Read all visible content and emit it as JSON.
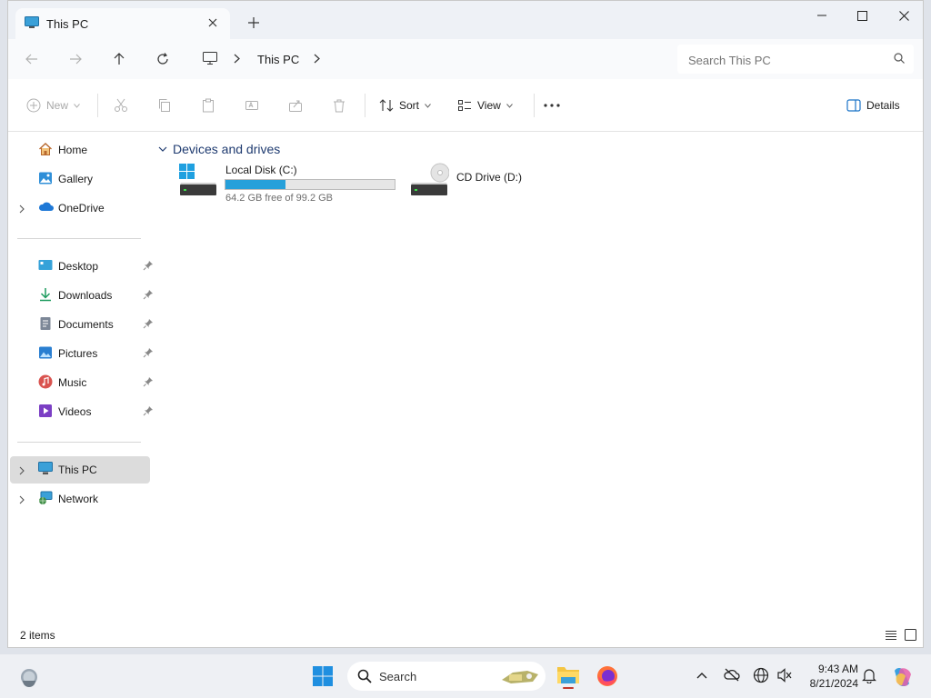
{
  "tab": {
    "title": "This PC"
  },
  "address": {
    "crumb": "This PC"
  },
  "search": {
    "placeholder": "Search This PC"
  },
  "commands": {
    "new": "New",
    "sort": "Sort",
    "view": "View",
    "details": "Details"
  },
  "sidebar": {
    "home": "Home",
    "gallery": "Gallery",
    "onedrive": "OneDrive",
    "desktop": "Desktop",
    "downloads": "Downloads",
    "documents": "Documents",
    "pictures": "Pictures",
    "music": "Music",
    "videos": "Videos",
    "thispc": "This PC",
    "network": "Network"
  },
  "main": {
    "group": "Devices and drives",
    "drives": [
      {
        "name": "Local Disk (C:)",
        "free": "64.2 GB free of 99.2 GB",
        "used_fraction": 0.353
      },
      {
        "name": "CD Drive (D:)"
      }
    ]
  },
  "status": {
    "count": "2 items"
  },
  "taskbar": {
    "search": "Search",
    "time": "9:43 AM",
    "date": "8/21/2024"
  },
  "colors": {
    "accent": "#26a0da",
    "folder": "#f4c542"
  }
}
